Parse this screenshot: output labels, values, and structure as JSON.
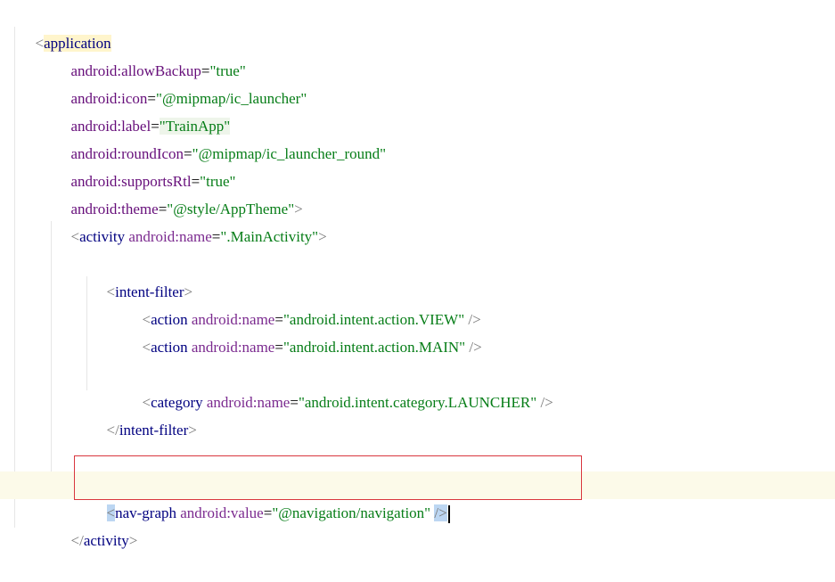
{
  "editor": {
    "lines": {
      "l1": {
        "lt": "<",
        "tag": "application"
      },
      "l2": {
        "attr": "android:allowBackup",
        "eq": "=",
        "val": "\"true\""
      },
      "l3": {
        "attr": "android:icon",
        "eq": "=",
        "val": "\"@mipmap/ic_launcher\""
      },
      "l4": {
        "attr": "android:label",
        "eq": "=",
        "val": "\"TrainApp\""
      },
      "l5": {
        "attr": "android:roundIcon",
        "eq": "=",
        "val": "\"@mipmap/ic_launcher_round\""
      },
      "l6": {
        "attr": "android:supportsRtl",
        "eq": "=",
        "val": "\"true\""
      },
      "l7": {
        "attr": "android:theme",
        "eq": "=",
        "val": "\"@style/AppTheme\"",
        "close": ">"
      },
      "l8": {
        "lt": "<",
        "tag": "activity",
        "attr": " android:name",
        "eq": "=",
        "val": "\".MainActivity\"",
        "close": ">"
      },
      "l10": {
        "lt": "<",
        "tag": "intent-filter",
        "close": ">"
      },
      "l11": {
        "lt": "<",
        "tag": "action",
        "attr": " android:name",
        "eq": "=",
        "val": "\"android.intent.action.VIEW\"",
        "close": " />"
      },
      "l12": {
        "lt": "<",
        "tag": "action",
        "attr": " android:name",
        "eq": "=",
        "val": "\"android.intent.action.MAIN\"",
        "close": " />"
      },
      "l14": {
        "lt": "<",
        "tag": "category",
        "attr": " android:name",
        "eq": "=",
        "val": "\"android.intent.category.LAUNCHER\"",
        "close": " />"
      },
      "l15": {
        "lt": "</",
        "tag": "intent-filter",
        "close": ">"
      },
      "l18": {
        "lt": "<",
        "tag": "nav-graph",
        "attr": " android:value",
        "eq": "=",
        "val": "\"@navigation/navigation\"",
        "sp": " ",
        "close": "/>"
      },
      "l19": {
        "lt": "</",
        "tag": "activity",
        "close": ">"
      }
    }
  },
  "colors": {
    "tag": "#000080",
    "attribute": "#660e7a",
    "value": "#067d17",
    "highlight_box": "#d9363e",
    "caret_row": "#fcfae9"
  }
}
